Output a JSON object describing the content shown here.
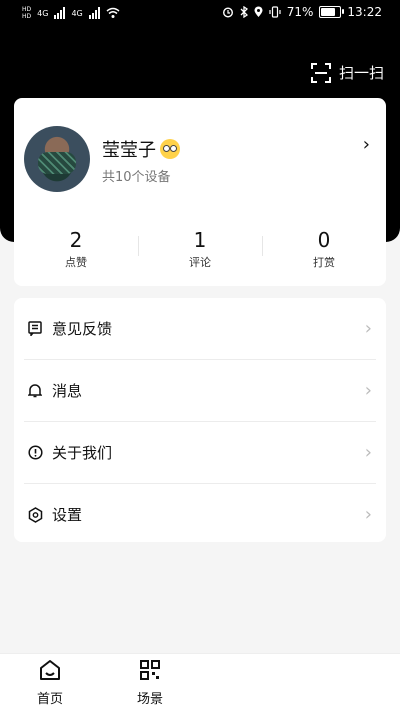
{
  "status_bar": {
    "carrier1": "HD",
    "carrier2": "HD",
    "net1": "4G",
    "net2": "4G",
    "battery": "71%",
    "time": "13:22"
  },
  "header": {
    "scan_label": "扫一扫"
  },
  "profile": {
    "name": "莹莹子",
    "device_count": "共10个设备"
  },
  "stats": [
    {
      "value": "2",
      "label": "点赞"
    },
    {
      "value": "1",
      "label": "评论"
    },
    {
      "value": "0",
      "label": "打赏"
    }
  ],
  "menu": [
    {
      "label": "意见反馈",
      "icon": "feedback-icon"
    },
    {
      "label": "消息",
      "icon": "bell-icon"
    },
    {
      "label": "关于我们",
      "icon": "info-icon"
    },
    {
      "label": "设置",
      "icon": "settings-icon"
    }
  ],
  "tabs": [
    {
      "label": "首页",
      "icon": "home-icon"
    },
    {
      "label": "场景",
      "icon": "grid-icon"
    }
  ]
}
